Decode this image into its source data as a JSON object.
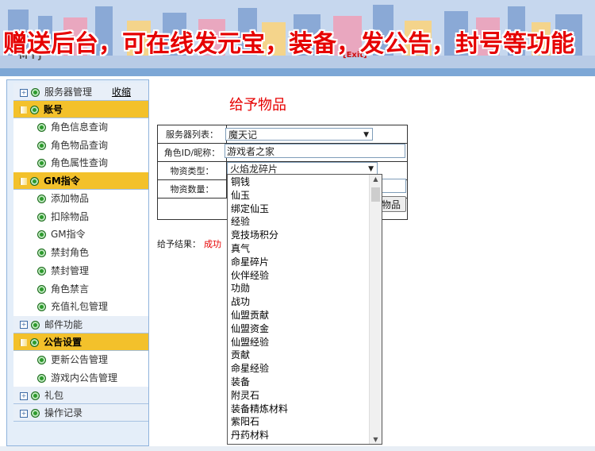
{
  "header": {
    "banner": "赠送后台，可在线发元宝，装备，发公告，封号等功能",
    "logo": "MTJ",
    "exit_label": "[Exit]"
  },
  "sidebar": {
    "collapse_label": "收缩",
    "groups": [
      {
        "label": "服务器管理",
        "active": false,
        "expanded": false
      },
      {
        "label": "账号",
        "active": true,
        "expanded": true,
        "items": [
          "角色信息查询",
          "角色物品查询",
          "角色属性查询"
        ]
      },
      {
        "label": "GM指令",
        "active": true,
        "expanded": true,
        "items": [
          "添加物品",
          "扣除物品",
          "GM指令",
          "禁封角色",
          "禁封管理",
          "角色禁言",
          "充值礼包管理"
        ]
      },
      {
        "label": "邮件功能",
        "active": false,
        "expanded": false
      },
      {
        "label": "公告设置",
        "active": true,
        "expanded": true,
        "items": [
          "更新公告管理",
          "游戏内公告管理"
        ]
      },
      {
        "label": "礼包",
        "active": false,
        "expanded": false
      },
      {
        "label": "操作记录",
        "active": false,
        "expanded": false
      }
    ]
  },
  "main": {
    "title": "给予物品",
    "form": {
      "server_label": "服务器列表：",
      "server_value": "魔天记",
      "role_label": "角色ID/昵称：",
      "role_value": "游戏者之家",
      "type_label": "物资类型：",
      "type_value": "火焰龙碎片",
      "qty_label": "物资数量：",
      "qty_value": "",
      "submit_label": "物品"
    },
    "result_label": "给予结果：",
    "result_value": "成功"
  },
  "dropdown": {
    "options": [
      "铜钱",
      "仙玉",
      "绑定仙玉",
      "经验",
      "竞技场积分",
      "真气",
      "命星碎片",
      "伙伴经验",
      "功勋",
      "战功",
      "仙盟贡献",
      "仙盟资金",
      "仙盟经验",
      "贡献",
      "命星经验",
      "装备",
      "附灵石",
      "装备精炼材料",
      "紫阳石",
      "丹药材料"
    ]
  },
  "colors": {
    "accent_red": "#e60000",
    "active_group": "#f3c12b",
    "sidebar_bg": "#e4eef9"
  }
}
